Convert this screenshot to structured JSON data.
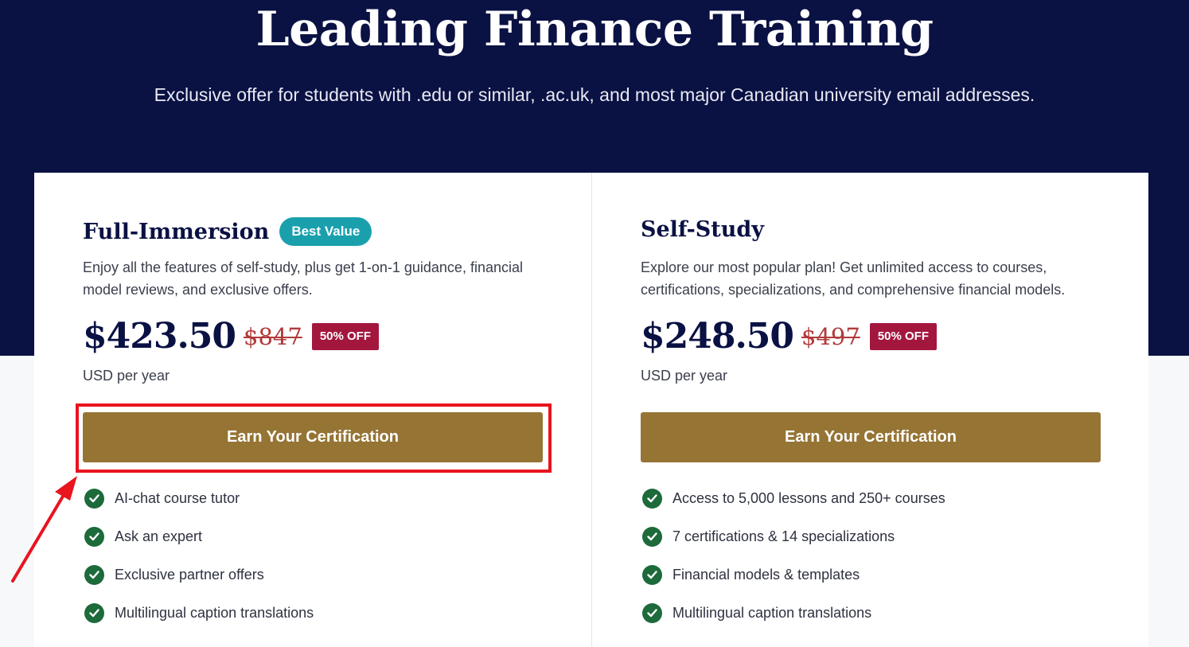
{
  "hero": {
    "title": "Leading Finance Training",
    "subtitle": "Exclusive offer for students with .edu or similar, .ac.uk, and most major Canadian university email addresses."
  },
  "plans": [
    {
      "name": "Full-Immersion",
      "badge": "Best Value",
      "description": "Enjoy all the features of self-study, plus get 1-on-1 guidance, financial model reviews, and exclusive offers.",
      "price": "$423.50",
      "old_price": "$847",
      "discount": "50% OFF",
      "period": "USD per year",
      "cta_label": "Earn Your Certification",
      "features": [
        "AI-chat course tutor",
        "Ask an expert",
        "Exclusive partner offers",
        "Multilingual caption translations"
      ]
    },
    {
      "name": "Self-Study",
      "description": "Explore our most popular plan! Get unlimited access to courses, certifications, specializations, and comprehensive financial models.",
      "price": "$248.50",
      "old_price": "$497",
      "discount": "50% OFF",
      "period": "USD per year",
      "cta_label": "Earn Your Certification",
      "features": [
        "Access to 5,000 lessons and 250+ courses",
        "7 certifications & 14 specializations",
        "Financial models & templates",
        "Multilingual caption translations"
      ]
    }
  ],
  "colors": {
    "hero_bg": "#0a1143",
    "cta_bg": "#957434",
    "badge_bg": "#1aa0ad",
    "discount_bg": "#a3173f",
    "check_bg": "#1d6a3a",
    "annotation": "#e8141e"
  },
  "icons": {
    "feature": "check-circle-icon",
    "annotation": "red-arrow-icon"
  }
}
